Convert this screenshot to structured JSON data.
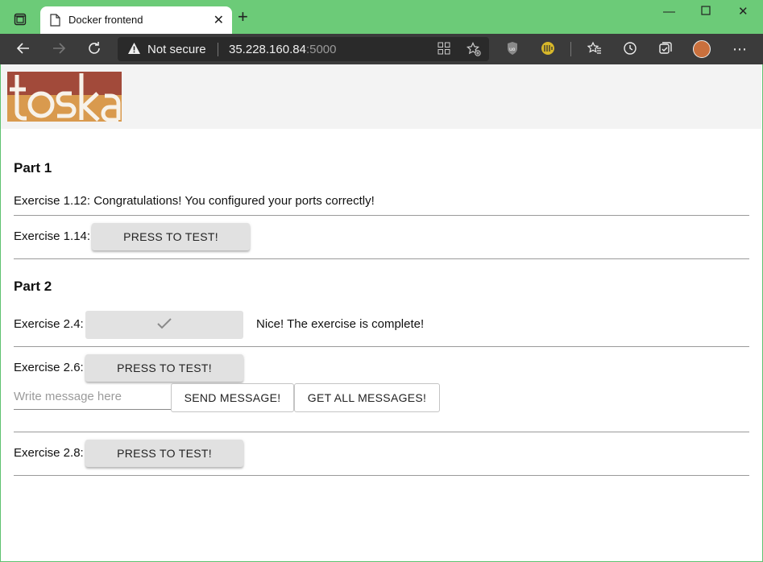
{
  "browser": {
    "tab_title": "Docker frontend",
    "security_label": "Not secure",
    "url_host": "35.228.160.84",
    "url_port": ":5000"
  },
  "logo": {
    "text": "toska",
    "colors": {
      "top": "#a24a3a",
      "bottom": "#d99a4e"
    }
  },
  "part1": {
    "heading": "Part 1",
    "ex112": "Exercise 1.12: Congratulations! You configured your ports correctly!",
    "ex114_label": "Exercise 1.14:",
    "ex114_button": "PRESS TO TEST!"
  },
  "part2": {
    "heading": "Part 2",
    "ex24_label": "Exercise 2.4:",
    "ex24_status": "Nice! The exercise is complete!",
    "ex26_label": "Exercise 2.6:",
    "ex26_button": "PRESS TO TEST!",
    "message_placeholder": "Write message here",
    "send_button": "SEND MESSAGE!",
    "get_button": "GET ALL MESSAGES!",
    "ex28_label": "Exercise 2.8:",
    "ex28_button": "PRESS TO TEST!"
  }
}
